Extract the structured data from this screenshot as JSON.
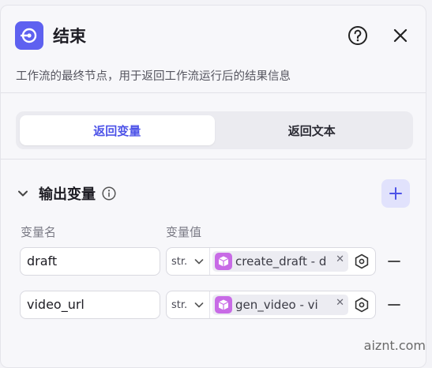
{
  "node": {
    "title": "结束",
    "description": "工作流的最终节点，用于返回工作流运行后的结果信息",
    "accent_color": "#5e61f0"
  },
  "tabs": [
    {
      "label": "返回变量",
      "active": true
    },
    {
      "label": "返回文本",
      "active": false
    }
  ],
  "output_section": {
    "title": "输出变量",
    "col_name": "变量名",
    "col_value": "变量值"
  },
  "rows": [
    {
      "name": "draft",
      "type": "str.",
      "ref": "create_draft - d",
      "ref_icon": "cube-icon"
    },
    {
      "name": "video_url",
      "type": "str.",
      "ref": "gen_video - vi",
      "ref_icon": "cube-icon"
    }
  ],
  "watermark": "aiznt.com"
}
